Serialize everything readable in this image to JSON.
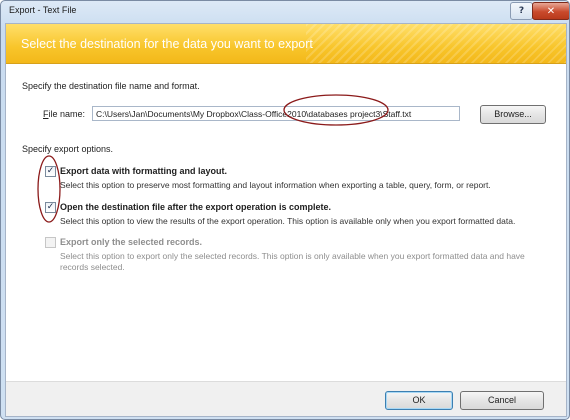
{
  "window": {
    "title": "Export - Text File",
    "help_glyph": "?",
    "close_glyph": "✕"
  },
  "banner": {
    "text": "Select the destination for the data you want to export"
  },
  "destination": {
    "section_label": "Specify the destination file name and format.",
    "file_name_label_accel": "F",
    "file_name_label_rest": "ile name:",
    "file_name_value": "C:\\Users\\Jan\\Documents\\My Dropbox\\Class-Office2010\\databases project3\\Staff.txt",
    "browse_label": "Browse..."
  },
  "options": {
    "section_label": "Specify export options.",
    "items": [
      {
        "label": "Export data with formatting and layout.",
        "description": "Select this option to preserve most formatting and layout information when exporting a table, query, form, or report.",
        "checked": true,
        "enabled": true
      },
      {
        "label": "Open the destination file after the export operation is complete.",
        "description": "Select this option to view the results of the export operation. This option is available only when you export formatted data.",
        "checked": true,
        "enabled": true
      },
      {
        "label": "Export only the selected records.",
        "description": "Select this option to export only the selected records. This option is only available when you export formatted data and have records selected.",
        "checked": false,
        "enabled": false
      }
    ]
  },
  "footer": {
    "ok_label": "OK",
    "cancel_label": "Cancel"
  },
  "colors": {
    "banner": "#f8c52a",
    "annotation": "#8b1a1a"
  }
}
